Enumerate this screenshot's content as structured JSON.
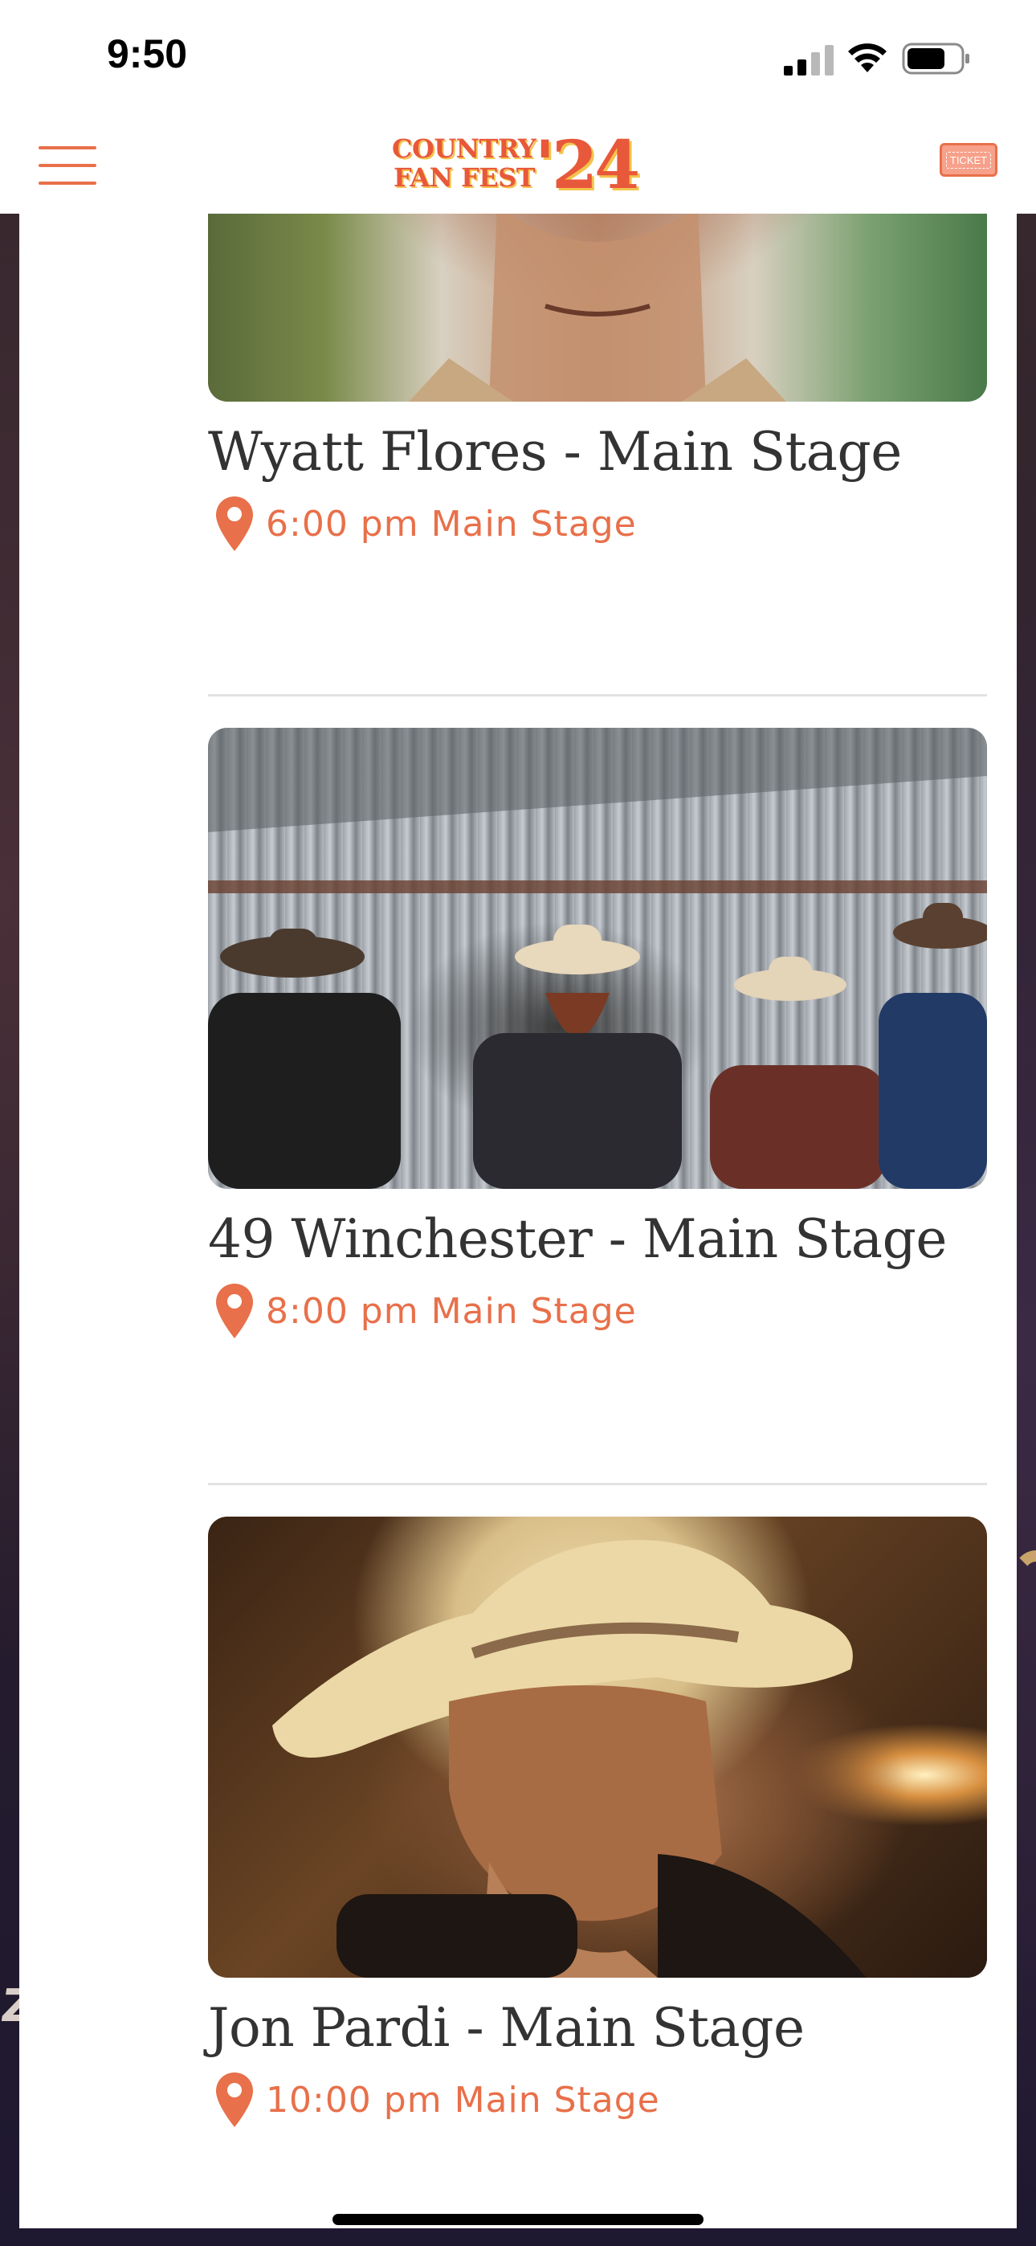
{
  "status_bar": {
    "time": "9:50"
  },
  "header": {
    "logo_line1": "COUNTRY",
    "logo_line2": "FAN FEST",
    "logo_year": "'24",
    "ticket_label": "TICKET"
  },
  "events": [
    {
      "title": "Wyatt Flores - Main Stage",
      "time_location": "6:00 pm Main Stage",
      "image_subject": "close-up portrait of singer in tan jacket"
    },
    {
      "title": "49 Winchester - Main Stage",
      "time_location": "8:00 pm Main Stage",
      "image_subject": "four-piece band in cowboy hats in metal barn"
    },
    {
      "title": "Jon Pardi - Main Stage",
      "time_location": "10:00 pm Main Stage",
      "image_subject": "singer in straw cowboy hat, hand on chin"
    }
  ],
  "colors": {
    "accent": "#e8704a",
    "logo": "#e8583a",
    "title_text": "#333333",
    "divider": "#e2e2e2"
  },
  "icons": [
    "menu-icon",
    "ticket-icon",
    "location-pin-icon",
    "signal-icon",
    "wifi-icon",
    "battery-icon"
  ]
}
